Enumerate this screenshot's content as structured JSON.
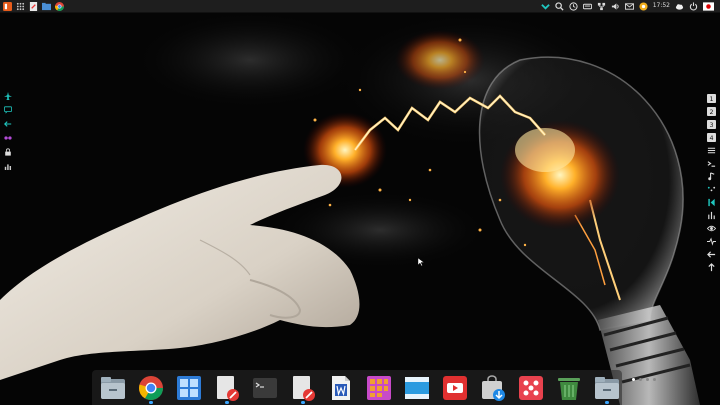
{
  "topbar": {
    "clock": "17:52"
  },
  "colors": {
    "topbar_bg": "#1e1e1e",
    "accent_teal": "#1fc7c0",
    "dock_indicator": "#3aa6ff"
  },
  "left_panel": {
    "icons": [
      "airplane-icon",
      "chat-icon",
      "arrow-left-icon",
      "glasses-icon",
      "lock-icon",
      "bar-chart-icon"
    ]
  },
  "right_panel": {
    "icons": [
      "workspace-1-icon",
      "workspace-2-icon",
      "workspace-3-icon",
      "workspace-4-icon",
      "menu-icon",
      "terminal-icon",
      "music-icon",
      "dots-icon",
      "skip-back-icon",
      "equalizer-icon",
      "eye-icon",
      "pulse-icon",
      "arrow-left-icon",
      "arrow-up-icon"
    ],
    "workspace_labels": [
      "1",
      "2",
      "3",
      "4"
    ]
  },
  "dock": {
    "apps": [
      "file-manager",
      "chrome-browser",
      "app-grid",
      "text-editor",
      "terminal",
      "document-editor",
      "writer",
      "mosaic-app",
      "window-app",
      "youtube",
      "app-store",
      "redhat-app",
      "trash",
      "file-manager-2"
    ],
    "running": [
      "chrome-browser",
      "text-editor",
      "document-editor",
      "file-manager-2"
    ],
    "pages": 4,
    "active_page": 1
  }
}
